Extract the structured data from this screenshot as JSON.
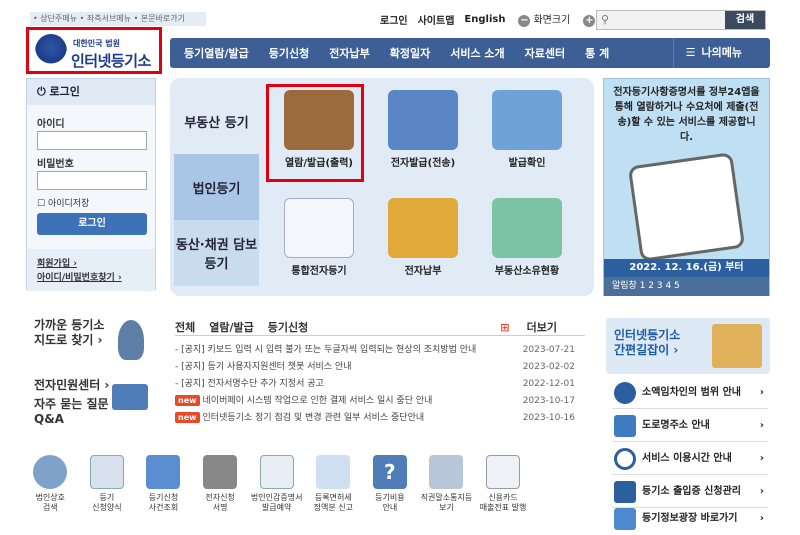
{
  "header": {
    "skip_links": "• 상단주메뉴 • 좌측서브메뉴 • 본문바로가기",
    "login": "로그인",
    "sitemap": "사이트맵",
    "english": "English",
    "zoom": "화면크기",
    "search_btn": "검색"
  },
  "logo": {
    "line1": "대한민국 법원",
    "line2": "인터넷등기소"
  },
  "nav": {
    "items": [
      "등기열람/발급",
      "등기신청",
      "전자납부",
      "확정일자",
      "서비스 소개",
      "자료센터",
      "통 계"
    ],
    "mymenu": "나의메뉴"
  },
  "login_box": {
    "title": "로그인",
    "id_label": "아이디",
    "pw_label": "비밀번호",
    "save_id": "아이디저장",
    "login_btn": "로그인",
    "join": "회원가입 ›",
    "find": "아이디/비밀번호찾기 ›"
  },
  "categories": {
    "realty": "부동산 등기",
    "corp": "법인등기",
    "movable": "동산·채권 담보 등기"
  },
  "tiles": [
    "열람/발급(출력)",
    "전자발급(전송)",
    "발급확인",
    "통합전자등기",
    "전자납부",
    "부동산소유현황"
  ],
  "banner": {
    "text": "전자등기사항증명서를 정부24앱을 통해 열람하거나 수요처에 제출(전송)할 수 있는 서비스를 제공합니다.",
    "date": "2022. 12. 16.(금) 부터",
    "ctr": "알림창 1 2 3 4 5"
  },
  "nearby": {
    "line1": "가까운 등기소",
    "line2": "지도로 찾기 ›",
    "civil": "전자민원센터 ›",
    "faq1": "자주 묻는 질문",
    "faq2": "Q&A"
  },
  "notice": {
    "tab1": "전체",
    "tab2": "열람/발급",
    "tab3": "등기신청",
    "more": "더보기",
    "rows": [
      {
        "t": "- [공지] 키보드 입력 시 입력 불가 또는 두글자씩 입력되는 현상의 조치방법 안내",
        "d": "2023-07-21",
        "n": false
      },
      {
        "t": "- [공지] 등기 사용자지원센터 챗봇 서비스 안내",
        "d": "2023-02-02",
        "n": false
      },
      {
        "t": "- [공지] 전자서명수단 추가 지정서 공고",
        "d": "2022-12-01",
        "n": false
      },
      {
        "t": "네이버페이 시스템 작업으로 인한 결제 서비스 일시 중단 안내",
        "d": "2023-10-17",
        "n": true
      },
      {
        "t": "인터넷등기소 정기 점검 및 변경 관련 일부 서비스 중단안내",
        "d": "2023-10-16",
        "n": true
      }
    ],
    "new_label": "new"
  },
  "guide": {
    "l1": "인터넷등기소",
    "l2": "간편길잡이 ›"
  },
  "right_items": [
    "소액임차인의 범위 안내",
    "도로명주소 안내",
    "서비스 이용시간 안내",
    "등기소 출입증 신청관리",
    "등기정보광장 바로가기"
  ],
  "bottom": [
    [
      "법인상호",
      "검색"
    ],
    [
      "등기",
      "신청양식"
    ],
    [
      "등기신청",
      "사건조회"
    ],
    [
      "전자신청",
      "서명"
    ],
    [
      "법인인감증명서",
      "발급예약"
    ],
    [
      "등록면허세",
      "정액분 신고"
    ],
    [
      "등기비용",
      "안내"
    ],
    [
      "직권말소통지등",
      "보기"
    ],
    [
      "신용카드",
      "매출전표 발행"
    ]
  ],
  "colors": {
    "nav": "#3d5f96",
    "highlight": "#e00010"
  }
}
